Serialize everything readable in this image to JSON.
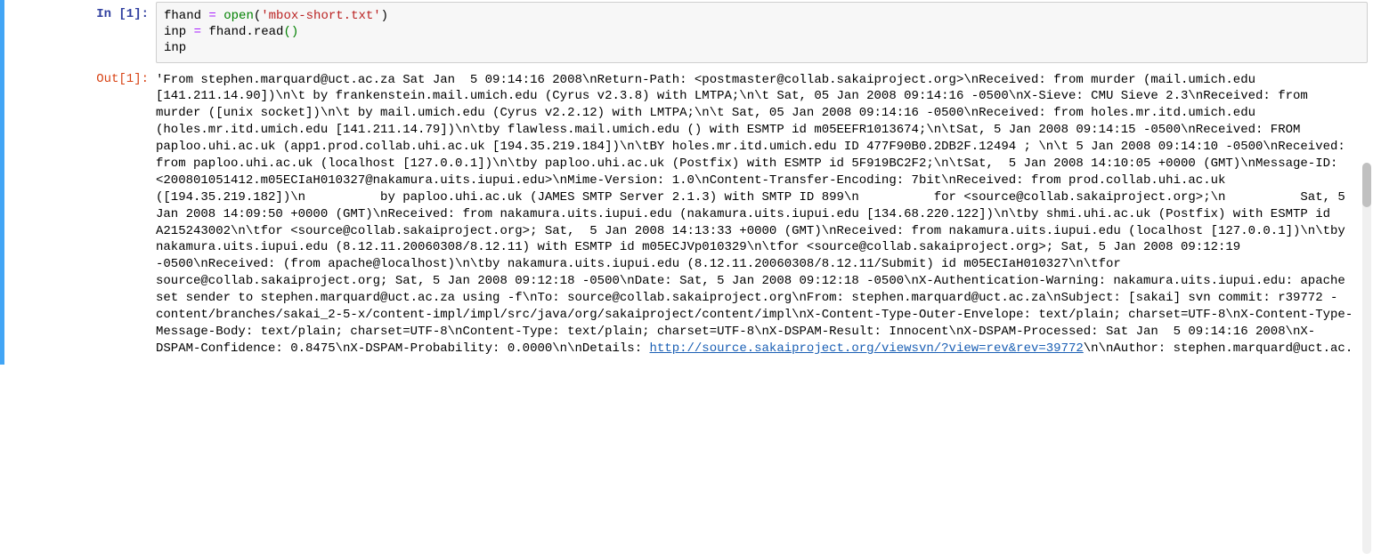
{
  "cells": {
    "in1": {
      "prompt": "In [1]:",
      "code": {
        "l1_var": "fhand ",
        "l1_op": "= ",
        "l1_builtin": "open",
        "l1_paren1": "(",
        "l1_str": "'mbox-short.txt'",
        "l1_paren2": ")",
        "l2_var": "inp ",
        "l2_op": "= ",
        "l2_rhs": "fhand.read",
        "l2_paren": "()",
        "l3": "inp"
      }
    },
    "out1": {
      "prompt": "Out[1]:",
      "text_before_link": "'From stephen.marquard@uct.ac.za Sat Jan  5 09:14:16 2008\\nReturn-Path: <postmaster@collab.sakaiproject.org>\\nReceived: from murder (mail.umich.edu [141.211.14.90])\\n\\t by frankenstein.mail.umich.edu (Cyrus v2.3.8) with LMTPA;\\n\\t Sat, 05 Jan 2008 09:14:16 -0500\\nX-Sieve: CMU Sieve 2.3\\nReceived: from murder ([unix socket])\\n\\t by mail.umich.edu (Cyrus v2.2.12) with LMTPA;\\n\\t Sat, 05 Jan 2008 09:14:16 -0500\\nReceived: from holes.mr.itd.umich.edu (holes.mr.itd.umich.edu [141.211.14.79])\\n\\tby flawless.mail.umich.edu () with ESMTP id m05EEFR1013674;\\n\\tSat, 5 Jan 2008 09:14:15 -0500\\nReceived: FROM paploo.uhi.ac.uk (app1.prod.collab.uhi.ac.uk [194.35.219.184])\\n\\tBY holes.mr.itd.umich.edu ID 477F90B0.2DB2F.12494 ; \\n\\t 5 Jan 2008 09:14:10 -0500\\nReceived: from paploo.uhi.ac.uk (localhost [127.0.0.1])\\n\\tby paploo.uhi.ac.uk (Postfix) with ESMTP id 5F919BC2F2;\\n\\tSat,  5 Jan 2008 14:10:05 +0000 (GMT)\\nMessage-ID: <200801051412.m05ECIaH010327@nakamura.uits.iupui.edu>\\nMime-Version: 1.0\\nContent-Transfer-Encoding: 7bit\\nReceived: from prod.collab.uhi.ac.uk ([194.35.219.182])\\n          by paploo.uhi.ac.uk (JAMES SMTP Server 2.1.3) with SMTP ID 899\\n          for <source@collab.sakaiproject.org>;\\n          Sat, 5 Jan 2008 14:09:50 +0000 (GMT)\\nReceived: from nakamura.uits.iupui.edu (nakamura.uits.iupui.edu [134.68.220.122])\\n\\tby shmi.uhi.ac.uk (Postfix) with ESMTP id A215243002\\n\\tfor <source@collab.sakaiproject.org>; Sat,  5 Jan 2008 14:13:33 +0000 (GMT)\\nReceived: from nakamura.uits.iupui.edu (localhost [127.0.0.1])\\n\\tby nakamura.uits.iupui.edu (8.12.11.20060308/8.12.11) with ESMTP id m05ECJVp010329\\n\\tfor <source@collab.sakaiproject.org>; Sat, 5 Jan 2008 09:12:19 -0500\\nReceived: (from apache@localhost)\\n\\tby nakamura.uits.iupui.edu (8.12.11.20060308/8.12.11/Submit) id m05ECIaH010327\\n\\tfor source@collab.sakaiproject.org; Sat, 5 Jan 2008 09:12:18 -0500\\nDate: Sat, 5 Jan 2008 09:12:18 -0500\\nX-Authentication-Warning: nakamura.uits.iupui.edu: apache set sender to stephen.marquard@uct.ac.za using -f\\nTo: source@collab.sakaiproject.org\\nFrom: stephen.marquard@uct.ac.za\\nSubject: [sakai] svn commit: r39772 - content/branches/sakai_2-5-x/content-impl/impl/src/java/org/sakaiproject/content/impl\\nX-Content-Type-Outer-Envelope: text/plain; charset=UTF-8\\nX-Content-Type-Message-Body: text/plain; charset=UTF-8\\nContent-Type: text/plain; charset=UTF-8\\nX-DSPAM-Result: Innocent\\nX-DSPAM-Processed: Sat Jan  5 09:14:16 2008\\nX-DSPAM-Confidence: 0.8475\\nX-DSPAM-Probability: 0.0000\\n\\nDetails: ",
      "link": "http://source.sakaiproject.org/viewsvn/?view=rev&rev=39772",
      "text_after_link": "\\n\\nAuthor: stephen.marquard@uct.ac."
    }
  }
}
